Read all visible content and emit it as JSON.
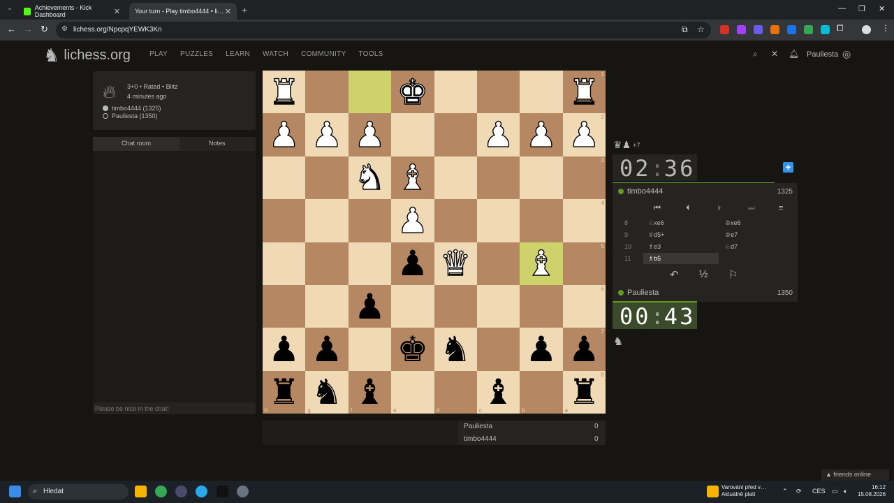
{
  "browser": {
    "tabs": [
      {
        "title": "Achievements - Kick Dashboard",
        "close": "✕"
      },
      {
        "title": "Your turn - Play timbo4444 • li…",
        "close": "✕"
      }
    ],
    "new_tab": "+",
    "url": "lichess.org/NpcpqYEWK3Kn",
    "window_controls": [
      "—",
      "❐",
      "✕"
    ],
    "accent": "#629924"
  },
  "site": {
    "logo": "lichess.org",
    "nav": [
      "PLAY",
      "PUZZLES",
      "LEARN",
      "WATCH",
      "COMMUNITY",
      "TOOLS"
    ],
    "username": "Pauliesta"
  },
  "game": {
    "type": "3+0 • Rated • Blitz",
    "time_ago": "4 minutes ago",
    "white_player": "timbo4444 (1325)",
    "black_player": "Pauliesta (1350)"
  },
  "chat": {
    "tabs": [
      "Chat room",
      "Notes"
    ],
    "placeholder": "Please be nice in the chat!"
  },
  "board": {
    "ranks": [
      "1",
      "2",
      "3",
      "4",
      "5",
      "6",
      "7",
      "8"
    ],
    "files": [
      "h",
      "g",
      "f",
      "e",
      "d",
      "c",
      "b",
      "a"
    ],
    "light": "#f0d9b5",
    "dark": "#b58863",
    "highlight": "#cdd26a",
    "pieces": [
      [
        "wR",
        "",
        "",
        "wK",
        "",
        "",
        "",
        "wR"
      ],
      [
        "wP",
        "wP",
        "wP",
        "",
        "",
        "wP",
        "wP",
        "wP"
      ],
      [
        "",
        "",
        "wN",
        "wB",
        "",
        "",
        "",
        ""
      ],
      [
        "",
        "",
        "",
        "wP",
        "",
        "",
        "",
        ""
      ],
      [
        "",
        "",
        "",
        "bP",
        "wQ",
        "",
        "wB",
        ""
      ],
      [
        "",
        "",
        "bP",
        "",
        "",
        "",
        "",
        ""
      ],
      [
        "bP",
        "bP",
        "",
        "bK",
        "bN",
        "",
        "bP",
        "bP"
      ],
      [
        "bR",
        "bN",
        "bB",
        "",
        "",
        "bB",
        "",
        "bR"
      ]
    ],
    "highlighted": [
      [
        0,
        2
      ],
      [
        4,
        6
      ]
    ]
  },
  "score": {
    "rows": [
      {
        "name": "Pauliesta",
        "value": "0"
      },
      {
        "name": "timbo4444",
        "value": "0"
      }
    ]
  },
  "panel": {
    "material_plus": "+7",
    "top_clock": {
      "min": "02",
      "sec": "36"
    },
    "bottom_clock": {
      "min": "00",
      "sec": "43"
    },
    "top_player": {
      "name": "timbo4444",
      "rating": "1325"
    },
    "bottom_player": {
      "name": "Pauliesta",
      "rating": "1350"
    },
    "moves": [
      {
        "n": "8",
        "w": "♘xe6",
        "b": "♔xe6"
      },
      {
        "n": "9",
        "w": "♕d5+",
        "b": "♔e7"
      },
      {
        "n": "10",
        "w": "♗e3",
        "b": "♘d7"
      },
      {
        "n": "11",
        "w": "♗b5",
        "b": ""
      }
    ],
    "half": "½"
  },
  "friends": "friends online",
  "taskbar": {
    "search": "Hledat",
    "warning_line1": "Varování před v…",
    "warning_line2": "Aktuálně platí",
    "lang": "CES",
    "time": "16:12",
    "date": "15.08.2026"
  }
}
